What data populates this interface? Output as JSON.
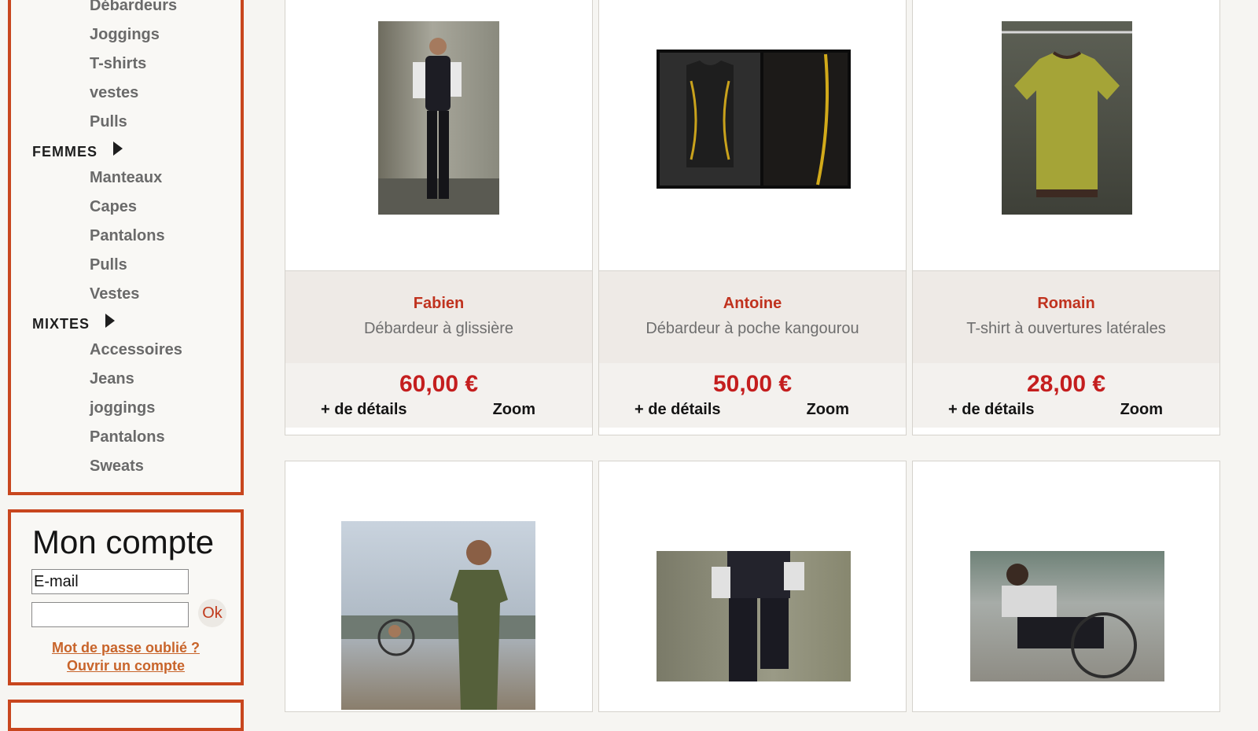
{
  "sidebar": {
    "categories": [
      {
        "label": "Débardeurs"
      },
      {
        "label": "Joggings"
      },
      {
        "label": "T-shirts"
      },
      {
        "label": "vestes"
      },
      {
        "label": "Pulls"
      },
      {
        "label": "FEMMES"
      },
      {
        "label": "Manteaux"
      },
      {
        "label": "Capes"
      },
      {
        "label": "Pantalons"
      },
      {
        "label": "Pulls"
      },
      {
        "label": "Vestes"
      },
      {
        "label": "MIXTES"
      },
      {
        "label": "Accessoires"
      },
      {
        "label": "Jeans"
      },
      {
        "label": "joggings"
      },
      {
        "label": "Pantalons"
      },
      {
        "label": "Sweats"
      }
    ]
  },
  "account": {
    "title": "Mon compte",
    "email_value": "E-mail",
    "password_value": "",
    "ok_label": "Ok",
    "forgot_label": "Mot de passe oublié ?",
    "register_label": "Ouvrir un compte"
  },
  "products": [
    {
      "name": "Fabien",
      "description": "Débardeur à glissière",
      "price": "60,00 €",
      "details_label": "+ de détails",
      "zoom_label": "Zoom"
    },
    {
      "name": "Antoine",
      "description": "Débardeur à poche kangourou",
      "price": "50,00 €",
      "details_label": "+ de détails",
      "zoom_label": "Zoom"
    },
    {
      "name": "Romain",
      "description": "T-shirt à ouvertures latérales",
      "price": "28,00 €",
      "details_label": "+ de détails",
      "zoom_label": "Zoom"
    }
  ],
  "colors": {
    "accent": "#c8461e",
    "price": "#c41e1e",
    "name": "#c0321e"
  }
}
